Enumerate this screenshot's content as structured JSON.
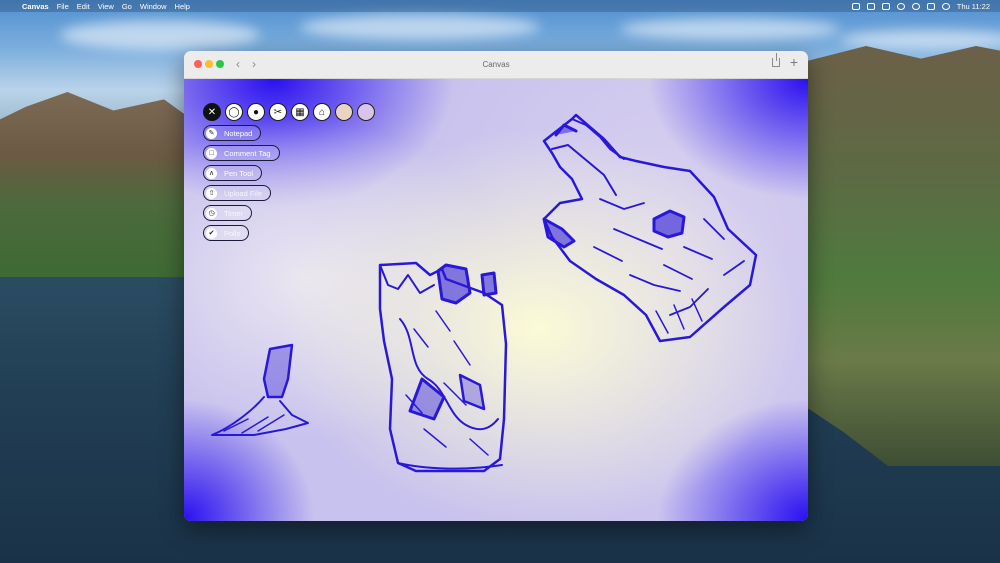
{
  "menubar": {
    "app_name": "Canvas",
    "items": [
      "File",
      "Edit",
      "View",
      "Go",
      "Window",
      "Help"
    ],
    "clock": "Thu 11:22"
  },
  "window": {
    "title": "Canvas"
  },
  "toolbar": {
    "icons": [
      "tools-icon",
      "speech-bubble-icon",
      "share-nodes-icon",
      "scissors-icon",
      "calendar-icon",
      "home-icon",
      "avatar-1",
      "avatar-2"
    ]
  },
  "menu": {
    "items": [
      {
        "label": "Notepad",
        "icon": "notepad-icon"
      },
      {
        "label": "Comment Tag",
        "icon": "comment-icon"
      },
      {
        "label": "Pen Tool",
        "icon": "pen-icon"
      },
      {
        "label": "Upload File",
        "icon": "upload-icon"
      },
      {
        "label": "Timer",
        "icon": "timer-icon"
      },
      {
        "label": "Polls",
        "icon": "thumbs-up-icon"
      }
    ]
  },
  "colors": {
    "ink": "#2a18d8",
    "canvas_blue": "#2a10f0",
    "canvas_cream": "#fbfbd6"
  }
}
